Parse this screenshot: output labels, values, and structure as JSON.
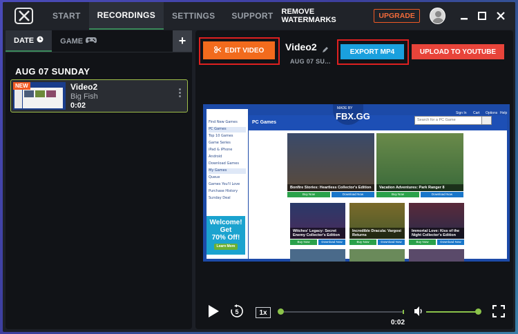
{
  "nav": {
    "tabs": [
      "START",
      "RECORDINGS",
      "SETTINGS",
      "SUPPORT"
    ],
    "remove_watermarks": "REMOVE WATERMARKS",
    "upgrade": "UPGRADE"
  },
  "left": {
    "tabs": [
      "DATE",
      "GAME"
    ],
    "date_header": "AUG 07  SUNDAY",
    "recording": {
      "badge": "NEW",
      "title": "Video2",
      "game": "Big Fish",
      "duration": "0:02"
    }
  },
  "right": {
    "edit_label": "EDIT VIDEO",
    "video_title": "Video2",
    "video_date": "AUG 07  SU...",
    "export_label": "EXPORT MP4",
    "youtube_label": "UPLOAD TO YOUTUBE",
    "player": {
      "speed": "1x",
      "time": "0:02",
      "progress": 0,
      "volume": 1.0
    }
  },
  "video_frame": {
    "section_title": "PC Games",
    "brand_top": "MADE BY",
    "brand": "FBX.GG",
    "search_placeholder": "Search for a PC Game",
    "header_links": [
      "Sign In",
      "Cart",
      "Options",
      "Help"
    ],
    "sidebar_items": [
      "Find New Games",
      "PC Games",
      "Top 10 Games",
      "Game Series",
      "iPad & iPhone",
      "Android",
      "Download Games",
      "My Games",
      "Queue",
      "Games You'll Love",
      "Purchase History",
      "Sunday Deal"
    ],
    "promo": {
      "line1": "Welcome!",
      "line2": "Get",
      "line3": "70% Off!",
      "cta": "Learn More"
    },
    "games": [
      {
        "title": "Bonfire Stories: Heartless Collector's Edition"
      },
      {
        "title": "Vacation Adventures: Park Ranger 8"
      },
      {
        "title": "Witches' Legacy: Secret Enemy Collector's Edition"
      },
      {
        "title": "Incredible Dracula: Vargosi Returns"
      },
      {
        "title": "Immortal Love: Kiss of the Night Collector's Edition"
      }
    ],
    "buy_label": "Buy Now",
    "download_label": "Download Now"
  },
  "colors": {
    "accent_green": "#8bc34a",
    "orange": "#f26b1d",
    "blue": "#1aa0de",
    "red": "#e8443a"
  }
}
